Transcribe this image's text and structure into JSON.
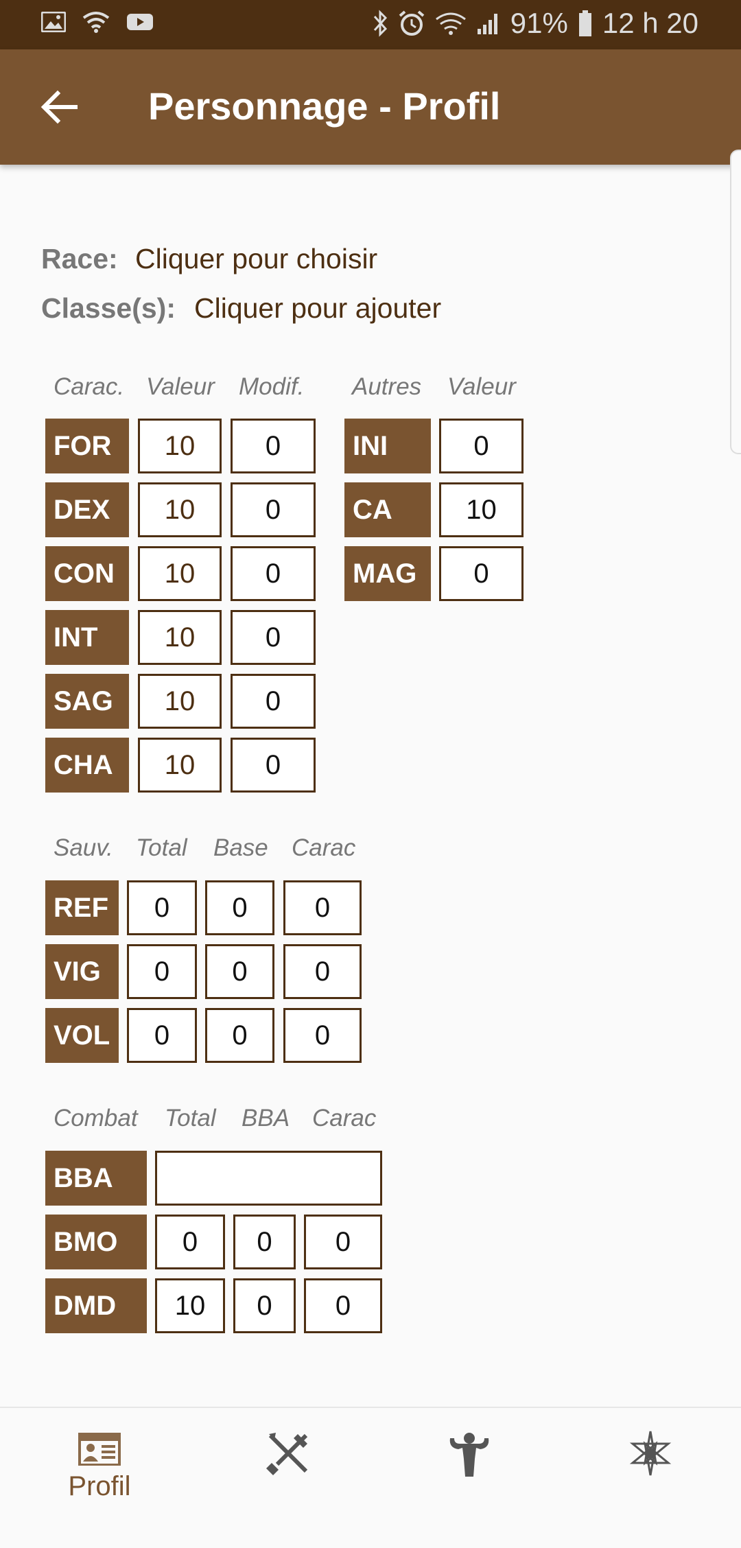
{
  "status_bar": {
    "icons_left": [
      "image-icon",
      "wifi-icon",
      "youtube-icon"
    ],
    "icons_right": [
      "bluetooth-icon",
      "alarm-icon",
      "wifi-signal-icon",
      "cell-signal-icon",
      "battery-icon"
    ],
    "battery": "91%",
    "time": "12 h 20"
  },
  "app_bar": {
    "title": "Personnage - Profil"
  },
  "profile": {
    "race_label": "Race:",
    "race_value": "Cliquer pour choisir",
    "class_label": "Classe(s):",
    "class_value": "Cliquer pour ajouter"
  },
  "stats": {
    "headers": [
      "Carac.",
      "Valeur",
      "Modif."
    ],
    "rows": [
      {
        "name": "FOR",
        "value": "10",
        "mod": "0"
      },
      {
        "name": "DEX",
        "value": "10",
        "mod": "0"
      },
      {
        "name": "CON",
        "value": "10",
        "mod": "0"
      },
      {
        "name": "INT",
        "value": "10",
        "mod": "0"
      },
      {
        "name": "SAG",
        "value": "10",
        "mod": "0"
      },
      {
        "name": "CHA",
        "value": "10",
        "mod": "0"
      }
    ]
  },
  "others": {
    "headers": [
      "Autres",
      "Valeur"
    ],
    "rows": [
      {
        "name": "INI",
        "value": "0"
      },
      {
        "name": "CA",
        "value": "10"
      },
      {
        "name": "MAG",
        "value": "0"
      }
    ]
  },
  "saves": {
    "headers": [
      "Sauv.",
      "Total",
      "Base",
      "Carac"
    ],
    "rows": [
      {
        "name": "REF",
        "total": "0",
        "base": "0",
        "carac": "0"
      },
      {
        "name": "VIG",
        "total": "0",
        "base": "0",
        "carac": "0"
      },
      {
        "name": "VOL",
        "total": "0",
        "base": "0",
        "carac": "0"
      }
    ]
  },
  "combat": {
    "headers": [
      "Combat",
      "Total",
      "BBA",
      "Carac"
    ],
    "bba": {
      "name": "BBA",
      "value": ""
    },
    "rows": [
      {
        "name": "BMO",
        "total": "0",
        "bba": "0",
        "carac": "0"
      },
      {
        "name": "DMD",
        "total": "10",
        "bba": "0",
        "carac": "0"
      }
    ]
  },
  "bottom_nav": {
    "items": [
      {
        "icon": "profile-card-icon",
        "label": "Profil"
      },
      {
        "icon": "crossed-tools-icon",
        "label": ""
      },
      {
        "icon": "muscle-body-icon",
        "label": ""
      },
      {
        "icon": "star-spell-icon",
        "label": ""
      }
    ]
  }
}
